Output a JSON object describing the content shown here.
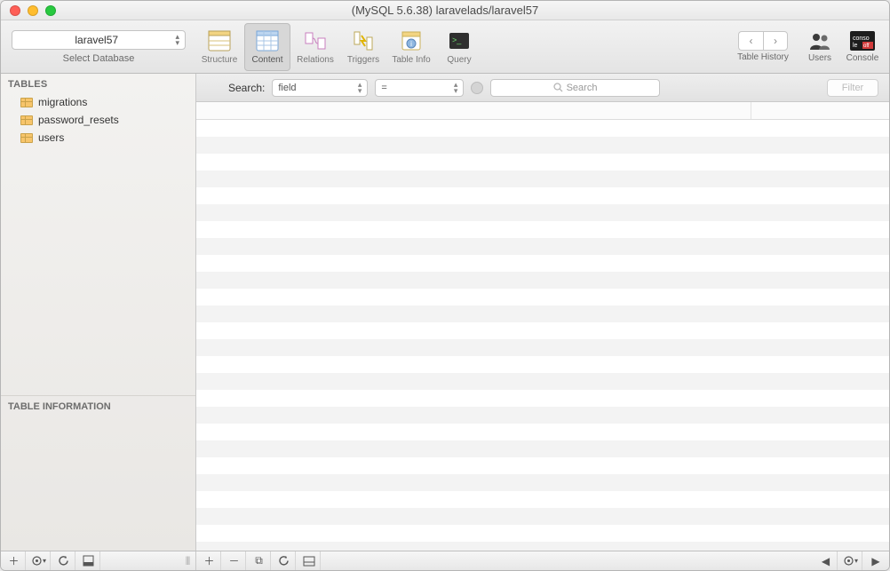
{
  "window": {
    "title": "(MySQL 5.6.38) laravelads/laravel57"
  },
  "db_selector": {
    "value": "laravel57",
    "caption": "Select Database"
  },
  "toolbar": {
    "structure": "Structure",
    "content": "Content",
    "relations": "Relations",
    "triggers": "Triggers",
    "table_info": "Table Info",
    "query": "Query",
    "table_history": "Table History",
    "users": "Users",
    "console": "Console"
  },
  "search": {
    "label": "Search:",
    "field_dropdown": "field",
    "operator_dropdown": "=",
    "placeholder": "Search",
    "filter": "Filter"
  },
  "sidebar": {
    "tables_header": "TABLES",
    "tables": [
      "migrations",
      "password_resets",
      "users"
    ],
    "info_header": "TABLE INFORMATION"
  }
}
